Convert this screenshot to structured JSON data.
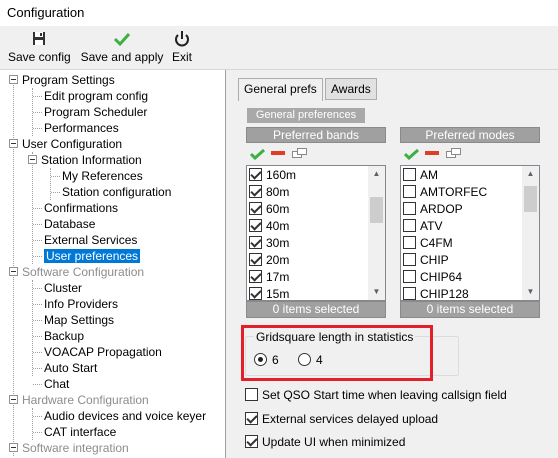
{
  "window": {
    "title": "Configuration"
  },
  "toolbar": {
    "save_config": "Save config",
    "save_apply": "Save and apply",
    "exit": "Exit"
  },
  "tree": {
    "items": [
      {
        "label": "Program Settings",
        "disabled": false
      },
      {
        "label": "Edit program config",
        "disabled": false
      },
      {
        "label": "Program Scheduler",
        "disabled": false
      },
      {
        "label": "Performances",
        "disabled": false
      },
      {
        "label": "User Configuration",
        "disabled": false
      },
      {
        "label": "Station Information",
        "disabled": false
      },
      {
        "label": "My References",
        "disabled": false
      },
      {
        "label": "Station configuration",
        "disabled": false
      },
      {
        "label": "Confirmations",
        "disabled": false
      },
      {
        "label": "Database",
        "disabled": false
      },
      {
        "label": "External Services",
        "disabled": false
      },
      {
        "label": "User preferences",
        "disabled": false,
        "selected": true
      },
      {
        "label": "Software Configuration",
        "disabled": true
      },
      {
        "label": "Cluster",
        "disabled": false
      },
      {
        "label": "Info Providers",
        "disabled": false
      },
      {
        "label": "Map Settings",
        "disabled": false
      },
      {
        "label": "Backup",
        "disabled": false
      },
      {
        "label": "VOACAP Propagation",
        "disabled": false
      },
      {
        "label": "Auto Start",
        "disabled": false
      },
      {
        "label": "Chat",
        "disabled": false
      },
      {
        "label": "Hardware Configuration",
        "disabled": true
      },
      {
        "label": "Audio devices and voice keyer",
        "disabled": false
      },
      {
        "label": "CAT interface",
        "disabled": false
      },
      {
        "label": "Software integration",
        "disabled": true
      }
    ]
  },
  "tabs": [
    {
      "label": "General prefs",
      "active": true
    },
    {
      "label": "Awards",
      "active": false
    }
  ],
  "group_label": "General preferences",
  "bands": {
    "header": "Preferred bands",
    "items": [
      {
        "label": "160m",
        "checked": true
      },
      {
        "label": "80m",
        "checked": true
      },
      {
        "label": "60m",
        "checked": true
      },
      {
        "label": "40m",
        "checked": true
      },
      {
        "label": "30m",
        "checked": true
      },
      {
        "label": "20m",
        "checked": true
      },
      {
        "label": "17m",
        "checked": true
      },
      {
        "label": "15m",
        "checked": true
      }
    ],
    "footer": "0 items selected",
    "scroll_fraction": 0.2
  },
  "modes": {
    "header": "Preferred modes",
    "items": [
      {
        "label": "AM",
        "checked": false
      },
      {
        "label": "AMTORFEC",
        "checked": false
      },
      {
        "label": "ARDOP",
        "checked": false
      },
      {
        "label": "ATV",
        "checked": false
      },
      {
        "label": "C4FM",
        "checked": false
      },
      {
        "label": "CHIP",
        "checked": false
      },
      {
        "label": "CHIP64",
        "checked": false
      },
      {
        "label": "CHIP128",
        "checked": false
      }
    ],
    "footer": "0 items selected",
    "scroll_fraction": 0.05
  },
  "gridsquare": {
    "legend": "Gridsquare length in statistics",
    "options": [
      "6",
      "4"
    ],
    "selected": "6"
  },
  "options": [
    {
      "label": "Set QSO Start time when leaving callsign field",
      "checked": false
    },
    {
      "label": "External services delayed upload",
      "checked": true
    },
    {
      "label": "Update UI when minimized",
      "checked": true
    }
  ],
  "colors": {
    "selection": "#0078d7",
    "highlight_box": "#e3202a",
    "check_icon": "#3cb043",
    "remove_icon": "#e03c28"
  }
}
